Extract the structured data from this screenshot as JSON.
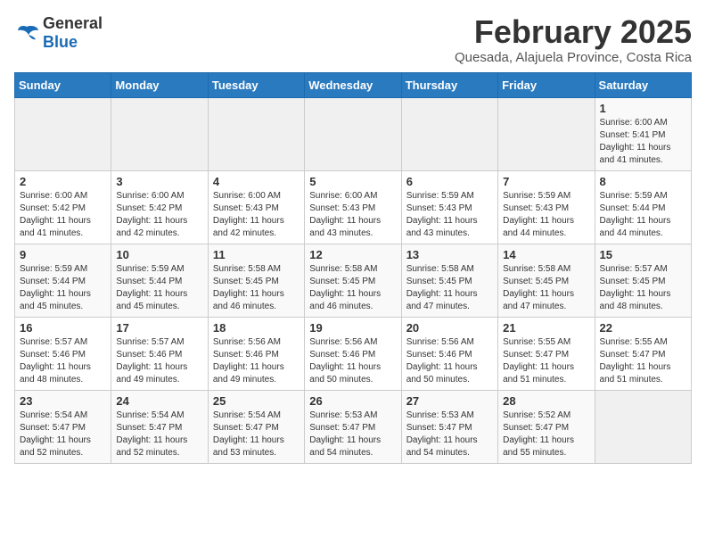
{
  "header": {
    "logo": {
      "general": "General",
      "blue": "Blue"
    },
    "title": "February 2025",
    "location": "Quesada, Alajuela Province, Costa Rica"
  },
  "calendar": {
    "days_of_week": [
      "Sunday",
      "Monday",
      "Tuesday",
      "Wednesday",
      "Thursday",
      "Friday",
      "Saturday"
    ],
    "weeks": [
      [
        {
          "day": "",
          "info": ""
        },
        {
          "day": "",
          "info": ""
        },
        {
          "day": "",
          "info": ""
        },
        {
          "day": "",
          "info": ""
        },
        {
          "day": "",
          "info": ""
        },
        {
          "day": "",
          "info": ""
        },
        {
          "day": "1",
          "info": "Sunrise: 6:00 AM\nSunset: 5:41 PM\nDaylight: 11 hours\nand 41 minutes."
        }
      ],
      [
        {
          "day": "2",
          "info": "Sunrise: 6:00 AM\nSunset: 5:42 PM\nDaylight: 11 hours\nand 41 minutes."
        },
        {
          "day": "3",
          "info": "Sunrise: 6:00 AM\nSunset: 5:42 PM\nDaylight: 11 hours\nand 42 minutes."
        },
        {
          "day": "4",
          "info": "Sunrise: 6:00 AM\nSunset: 5:43 PM\nDaylight: 11 hours\nand 42 minutes."
        },
        {
          "day": "5",
          "info": "Sunrise: 6:00 AM\nSunset: 5:43 PM\nDaylight: 11 hours\nand 43 minutes."
        },
        {
          "day": "6",
          "info": "Sunrise: 5:59 AM\nSunset: 5:43 PM\nDaylight: 11 hours\nand 43 minutes."
        },
        {
          "day": "7",
          "info": "Sunrise: 5:59 AM\nSunset: 5:43 PM\nDaylight: 11 hours\nand 44 minutes."
        },
        {
          "day": "8",
          "info": "Sunrise: 5:59 AM\nSunset: 5:44 PM\nDaylight: 11 hours\nand 44 minutes."
        }
      ],
      [
        {
          "day": "9",
          "info": "Sunrise: 5:59 AM\nSunset: 5:44 PM\nDaylight: 11 hours\nand 45 minutes."
        },
        {
          "day": "10",
          "info": "Sunrise: 5:59 AM\nSunset: 5:44 PM\nDaylight: 11 hours\nand 45 minutes."
        },
        {
          "day": "11",
          "info": "Sunrise: 5:58 AM\nSunset: 5:45 PM\nDaylight: 11 hours\nand 46 minutes."
        },
        {
          "day": "12",
          "info": "Sunrise: 5:58 AM\nSunset: 5:45 PM\nDaylight: 11 hours\nand 46 minutes."
        },
        {
          "day": "13",
          "info": "Sunrise: 5:58 AM\nSunset: 5:45 PM\nDaylight: 11 hours\nand 47 minutes."
        },
        {
          "day": "14",
          "info": "Sunrise: 5:58 AM\nSunset: 5:45 PM\nDaylight: 11 hours\nand 47 minutes."
        },
        {
          "day": "15",
          "info": "Sunrise: 5:57 AM\nSunset: 5:45 PM\nDaylight: 11 hours\nand 48 minutes."
        }
      ],
      [
        {
          "day": "16",
          "info": "Sunrise: 5:57 AM\nSunset: 5:46 PM\nDaylight: 11 hours\nand 48 minutes."
        },
        {
          "day": "17",
          "info": "Sunrise: 5:57 AM\nSunset: 5:46 PM\nDaylight: 11 hours\nand 49 minutes."
        },
        {
          "day": "18",
          "info": "Sunrise: 5:56 AM\nSunset: 5:46 PM\nDaylight: 11 hours\nand 49 minutes."
        },
        {
          "day": "19",
          "info": "Sunrise: 5:56 AM\nSunset: 5:46 PM\nDaylight: 11 hours\nand 50 minutes."
        },
        {
          "day": "20",
          "info": "Sunrise: 5:56 AM\nSunset: 5:46 PM\nDaylight: 11 hours\nand 50 minutes."
        },
        {
          "day": "21",
          "info": "Sunrise: 5:55 AM\nSunset: 5:47 PM\nDaylight: 11 hours\nand 51 minutes."
        },
        {
          "day": "22",
          "info": "Sunrise: 5:55 AM\nSunset: 5:47 PM\nDaylight: 11 hours\nand 51 minutes."
        }
      ],
      [
        {
          "day": "23",
          "info": "Sunrise: 5:54 AM\nSunset: 5:47 PM\nDaylight: 11 hours\nand 52 minutes."
        },
        {
          "day": "24",
          "info": "Sunrise: 5:54 AM\nSunset: 5:47 PM\nDaylight: 11 hours\nand 52 minutes."
        },
        {
          "day": "25",
          "info": "Sunrise: 5:54 AM\nSunset: 5:47 PM\nDaylight: 11 hours\nand 53 minutes."
        },
        {
          "day": "26",
          "info": "Sunrise: 5:53 AM\nSunset: 5:47 PM\nDaylight: 11 hours\nand 54 minutes."
        },
        {
          "day": "27",
          "info": "Sunrise: 5:53 AM\nSunset: 5:47 PM\nDaylight: 11 hours\nand 54 minutes."
        },
        {
          "day": "28",
          "info": "Sunrise: 5:52 AM\nSunset: 5:47 PM\nDaylight: 11 hours\nand 55 minutes."
        },
        {
          "day": "",
          "info": ""
        }
      ]
    ]
  }
}
